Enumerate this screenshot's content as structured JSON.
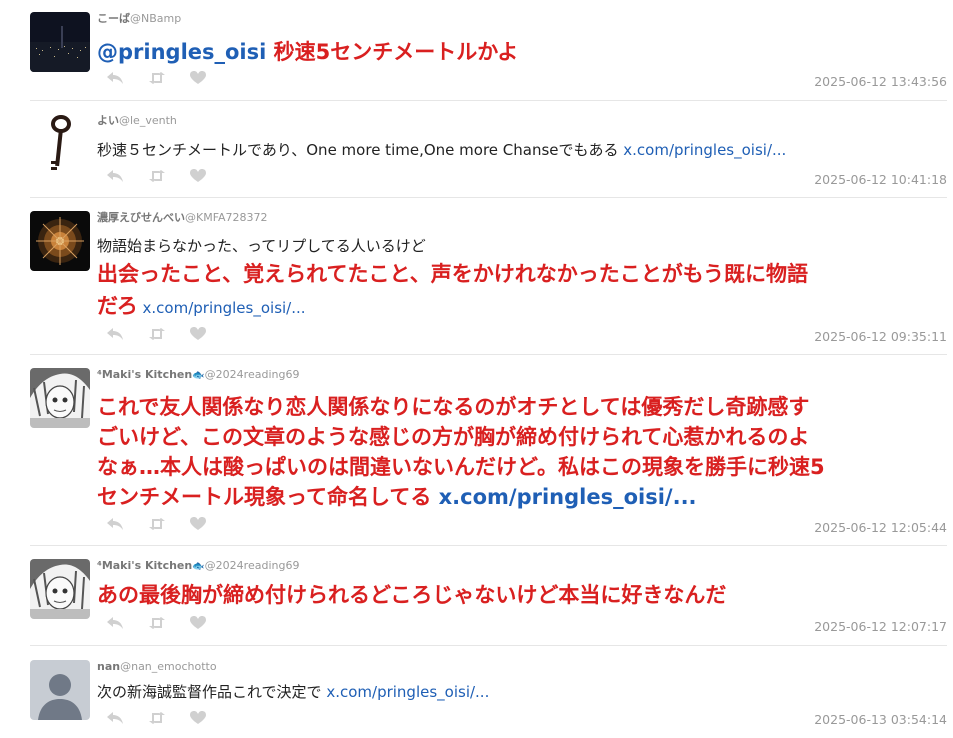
{
  "posts": [
    {
      "author": "こーば",
      "handle": "@NBamp",
      "lines": [
        {
          "style": "big",
          "segments": [
            {
              "text": "@pringles_oisi",
              "color": "link"
            },
            {
              "text": " 秒速5センチメートルかよ",
              "color": "red"
            }
          ]
        }
      ],
      "timestamp": "2025-06-12 13:43:56"
    },
    {
      "author": "よい",
      "handle": "@le_venth",
      "lines": [
        {
          "style": "small",
          "segments": [
            {
              "text": "秒速５センチメートルであり、One more time,One more Chanseでもある ",
              "color": "normal"
            },
            {
              "text": "x.com/pringles_oisi/...",
              "color": "link"
            }
          ]
        }
      ],
      "timestamp": "2025-06-12 10:41:18"
    },
    {
      "author": "濃厚えびせんべい",
      "handle": "@KMFA728372",
      "lines": [
        {
          "style": "small",
          "segments": [
            {
              "text": "物語始まらなかった、ってリプしてる人いるけど",
              "color": "normal"
            }
          ]
        },
        {
          "style": "big",
          "segments": [
            {
              "text": "出会ったこと、覚えられてたこと、声をかけれなかったことがもう既に物語",
              "color": "red"
            }
          ]
        },
        {
          "style": "mixed",
          "segments": [
            {
              "text": "だろ",
              "color": "red",
              "big": true
            },
            {
              "text": " x.com/pringles_oisi/...",
              "color": "link",
              "big": false
            }
          ]
        }
      ],
      "timestamp": "2025-06-12 09:35:11"
    },
    {
      "author": "⁴Maki's Kitchen",
      "emoji": "🐟",
      "handle": "@2024reading69",
      "lines": [
        {
          "style": "big",
          "segments": [
            {
              "text": "これで友人関係なり恋人関係なりになるのがオチとしては優秀だし奇跡感す",
              "color": "red"
            }
          ]
        },
        {
          "style": "big",
          "segments": [
            {
              "text": "ごいけど、この文章のような感じの方が胸が締め付けられて心惹かれるのよ",
              "color": "red"
            }
          ]
        },
        {
          "style": "big",
          "segments": [
            {
              "text": "なぁ…本人は酸っぱいのは間違いないんだけど。私はこの現象を勝手に秒速5",
              "color": "red"
            }
          ]
        },
        {
          "style": "big",
          "segments": [
            {
              "text": "センチメートル現象って命名してる ",
              "color": "red"
            },
            {
              "text": "x.com/pringles_oisi/...",
              "color": "link"
            }
          ]
        }
      ],
      "timestamp": "2025-06-12 12:05:44"
    },
    {
      "author": "⁴Maki's Kitchen",
      "emoji": "🐟",
      "handle": "@2024reading69",
      "lines": [
        {
          "style": "big",
          "segments": [
            {
              "text": "あの最後胸が締め付けられるどころじゃないけど本当に好きなんだ",
              "color": "red"
            }
          ]
        }
      ],
      "timestamp": "2025-06-12 12:07:17"
    },
    {
      "author": "nan",
      "handle": "@nan_emochotto",
      "lines": [
        {
          "style": "small",
          "segments": [
            {
              "text": "次の新海誠監督作品これで決定で ",
              "color": "normal"
            },
            {
              "text": "x.com/pringles_oisi/...",
              "color": "link"
            }
          ]
        }
      ],
      "timestamp": "2025-06-13 03:54:14"
    }
  ],
  "action_icons": [
    "reply-icon",
    "retweet-icon",
    "like-icon"
  ],
  "colors": {
    "red": "#d92020",
    "link": "#1f5fb5",
    "muted": "#999999",
    "icon": "#d0d0d0"
  }
}
